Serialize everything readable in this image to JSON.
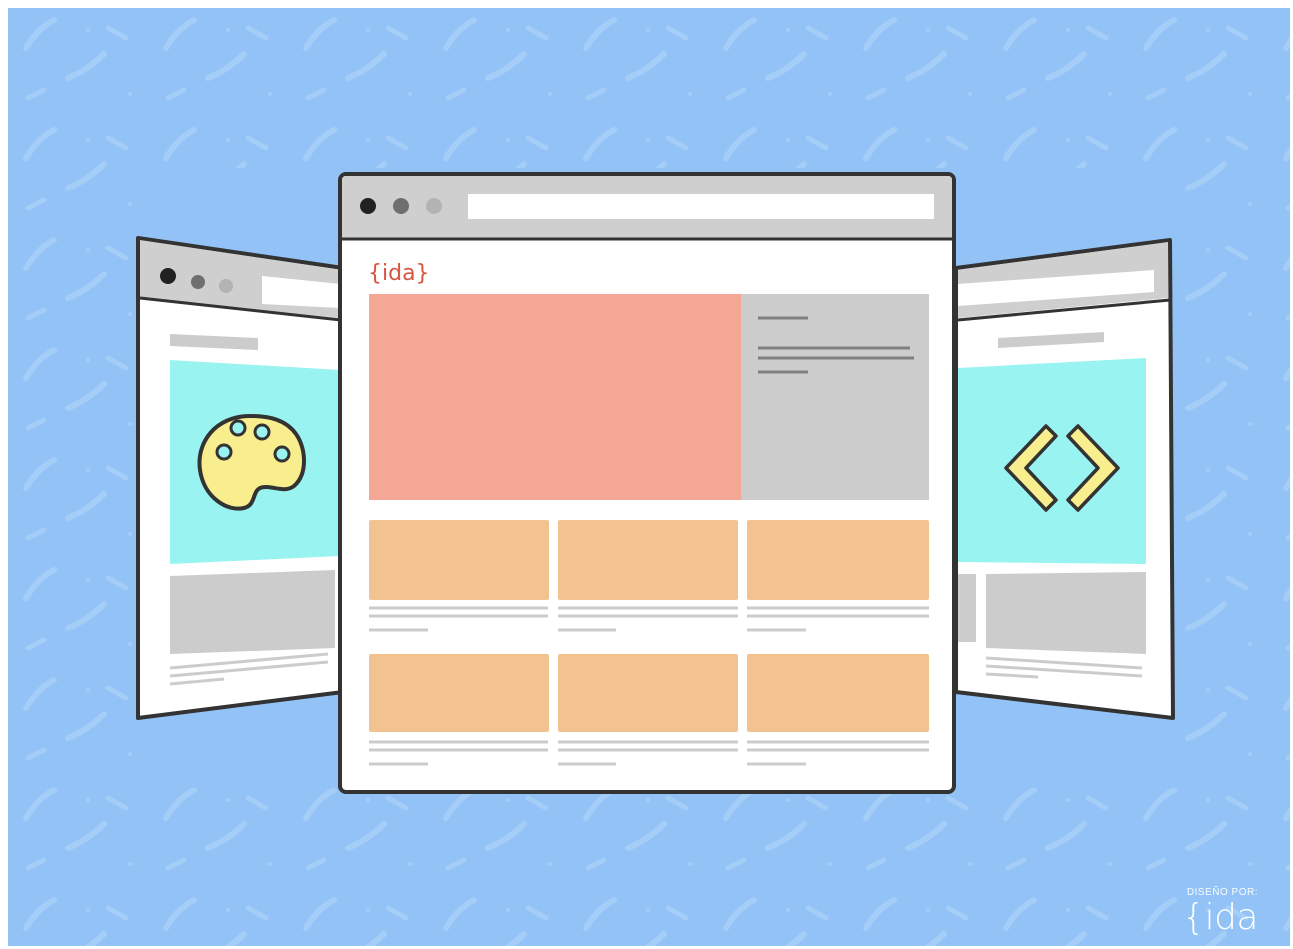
{
  "main_window": {
    "logo": "{ida}"
  },
  "icons": {
    "left_window": "palette-icon",
    "right_window": "code-brackets-icon"
  },
  "credit": {
    "caption": "DISEÑO POR:",
    "logo": "{ida"
  },
  "colors": {
    "background": "#93c3f6",
    "hero": "#f5a795",
    "cards": "#f2c391",
    "side_panel": "#cccccc",
    "side_hero": "#99f4f1",
    "icon_yellow": "#f8ee8e",
    "outline": "#333333",
    "brand": "#d9553f"
  }
}
